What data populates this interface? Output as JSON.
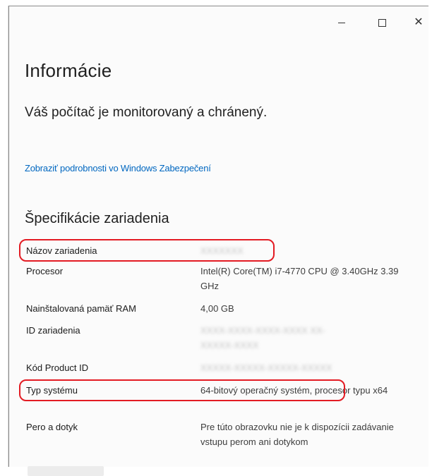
{
  "window": {
    "controls": {
      "minimize_icon": "minimize-icon",
      "maximize_icon": "maximize-icon",
      "close_glyph": "✕"
    }
  },
  "page": {
    "title": "Informácie",
    "status": "Váš počítač je monitorovaný a chránený.",
    "security_link": "Zobraziť podrobnosti vo Windows Zabezpečení"
  },
  "specs": {
    "section_title": "Špecifikácie zariadenia",
    "rows": [
      {
        "label": "Názov zariadenia",
        "value": "XXXXXXX"
      },
      {
        "label": "Procesor",
        "value": "Intel(R) Core(TM) i7-4770 CPU @ 3.40GHz   3.39 GHz"
      },
      {
        "label": "Nainštalovaná pamäť RAM",
        "value": "4,00 GB"
      },
      {
        "label": "ID zariadenia",
        "value": "XXXX-XXXX-XXXX-XXXX XX-XXXXX-XXXX"
      },
      {
        "label": "Kód Product ID",
        "value": "XXXXX-XXXXX-XXXXX-XXXXX"
      },
      {
        "label": "Typ systému",
        "value": "64-bitový operačný systém, procesor typu x64"
      },
      {
        "label": "Pero a dotyk",
        "value": "Pre túto obrazovku nie je k dispozícii zadávanie vstupu perom ani dotykom"
      }
    ]
  },
  "colors": {
    "highlight": "#e31b23",
    "link": "#0067c0"
  }
}
